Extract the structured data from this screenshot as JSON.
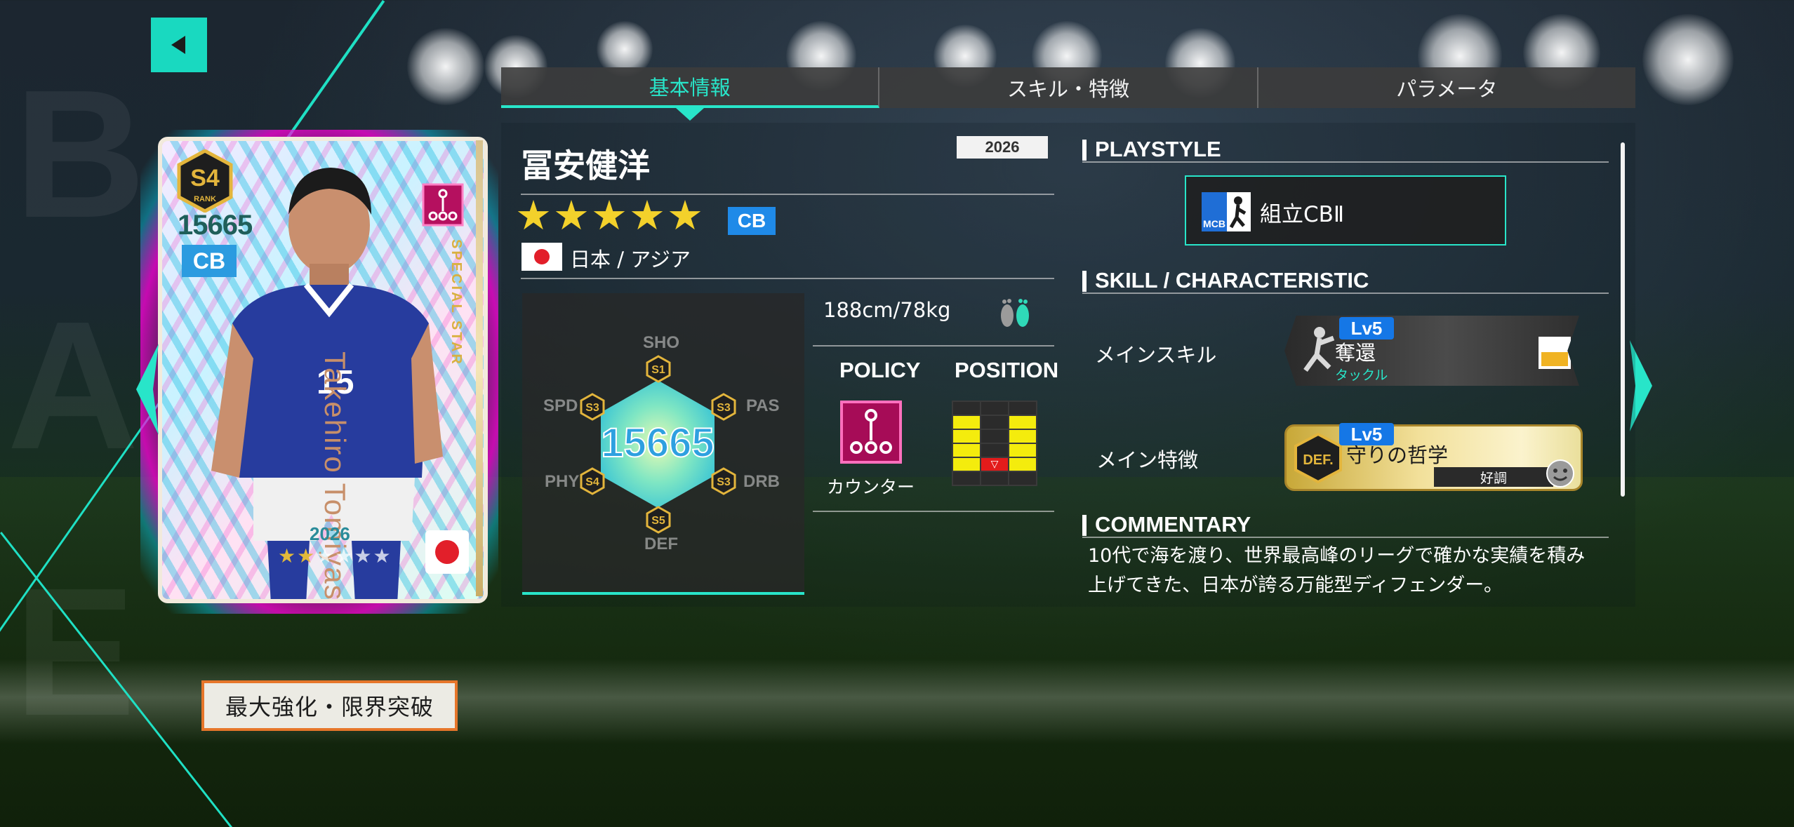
{
  "tabs": [
    {
      "label": "基本情報",
      "active": true
    },
    {
      "label": "スキル・特徴",
      "active": false
    },
    {
      "label": "パラメータ",
      "active": false
    }
  ],
  "player": {
    "name": "冨安健洋",
    "year": "2026",
    "stars": "★★★★★",
    "position": "CB",
    "nation": "日本 / アジア",
    "body": "188cm/78kg",
    "overall": "15665"
  },
  "card": {
    "rank": "S4",
    "rank_sub": "RANK",
    "overall": "15665",
    "position": "CB",
    "name_vertical": "Takehiro Tomiyasu",
    "special_text": "SPECIAL STAR",
    "year": "2026",
    "stars_filled": "★★",
    "stars_empty": "★★★★",
    "jersey_number": "15"
  },
  "stats": {
    "sho": {
      "label": "SHO",
      "grade": "S1"
    },
    "pas": {
      "label": "PAS",
      "grade": "S3"
    },
    "drb": {
      "label": "DRB",
      "grade": "S3"
    },
    "def": {
      "label": "DEF",
      "grade": "S5"
    },
    "phy": {
      "label": "PHY",
      "grade": "S4"
    },
    "spd": {
      "label": "SPD",
      "grade": "S3"
    }
  },
  "policy": {
    "title": "POLICY",
    "value": "カウンター"
  },
  "position_map": {
    "title": "POSITION"
  },
  "playstyle": {
    "heading": "PLAYSTYLE",
    "badge": "MCB",
    "value": "組立CBⅡ"
  },
  "skill": {
    "heading": "SKILL / CHARACTERISTIC",
    "main_skill_label": "メインスキル",
    "main_skill_lv": "Lv5",
    "main_skill_name": "奪還",
    "main_skill_type": "タックル",
    "main_feature_label": "メイン特徴",
    "main_feature_lv": "Lv5",
    "main_feature_tag": "DEF.",
    "main_feature_name": "守りの哲学",
    "main_feature_status": "好調"
  },
  "commentary": {
    "heading": "COMMENTARY",
    "text": "10代で海を渡り、世界最高峰のリーグで確かな実績を積み上げてきた、日本が誇る万能型ディフェンダー。"
  },
  "buttons": {
    "limit_break": "最大強化・限界突破"
  },
  "colors": {
    "accent": "#28e5c9",
    "position_blue": "#1f8ae8",
    "star_yellow": "#f3d12b",
    "limit_border": "#e6762a"
  }
}
